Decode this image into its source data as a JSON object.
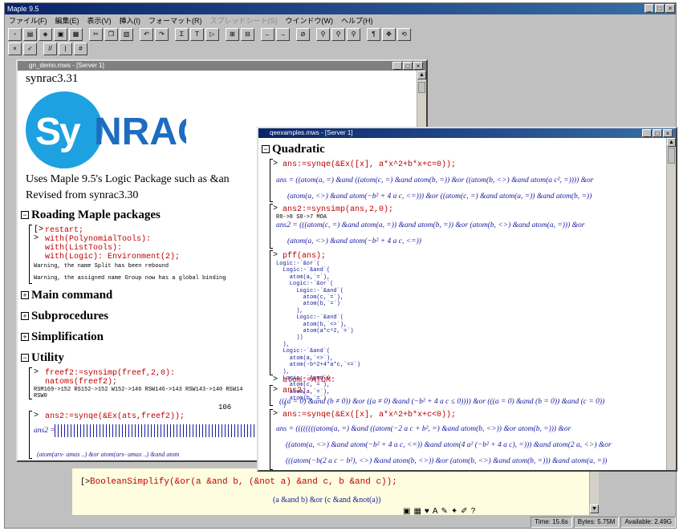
{
  "app": {
    "title": "Maple 9.5"
  },
  "menu": [
    "ファイル(F)",
    "編集(E)",
    "表示(V)",
    "挿入(I)",
    "フォーマット(R)",
    "スプレッドシート(S)",
    "ウインドウ(W)",
    "ヘルプ(H)"
  ],
  "win1": {
    "title": "gn_demo.mws - [Server 1]",
    "heading": "synrac3.31",
    "logo": "SyNRAC",
    "desc1": "Uses Maple 9.5's Logic Package such as &an",
    "desc2": "Revised from synrac3.30",
    "sections": {
      "s1": "Roading Maple packages",
      "s2": "Main command",
      "s3": "Subprocedures",
      "s4": "Simplification",
      "s5": "Utility"
    },
    "code1": "restart;\nwith(PolynomialTools):\nwith(ListTools):\nwith(Logic): Environment(2);",
    "warn1": "Warning, the name Split has been rebound",
    "warn2": "Warning, the assigned name Group now has a global binding",
    "code2": "freef2:=synsimp(freef,2,0):\nnatoms(freef2);",
    "out2": "RSM169->152 RS152->152 W152->146 RSW146->143 RSW143->140 RSW14\nRSW0",
    "num": "106",
    "code3": "ans2:=synqe(&Ex(ats,freef2));",
    "ans2": "ans2 =",
    "cut": "(atom(ars- amax ..) &or atom(ars- amax ..) &and atom"
  },
  "win2": {
    "title": "qeexamples.mws - [Server 1]",
    "heading": "Quadratic",
    "c1": "ans:=synqe(&Ex([x], a*x^2+b*x+c=0));",
    "m1a": "ans = ((atom(a, =) &and ((atom(c, =) &and atom(b, =)) &or ((atom(b, <>) &and atom(a c², =)))) &or",
    "m1b": "(atom(a, <>) &and atom(−b² + 4 a c, <=))) &or ((atom(c, =) &and atom(a, =)) &and atom(b, =))",
    "c2": "ans2:=synsimp(ans,2,0);",
    "o2": "R8->8 S8->7 MOA",
    "m2a": "ans2 = (((atom(c, =) &and atom(a, =)) &and atom(b, =)) &or (atom(b, <>) &and atom(a, =))) &or",
    "m2b": "(atom(a, <>) &and atom(−b² + 4 a c, <=))",
    "c3": "pff(ans);",
    "o3": "Logic:-`&or`(\n  Logic:-`&and`(\n    atom(a,`=`),\n    Logic:-`&or`(\n      Logic:-`&and`(\n        atom(c,`=`),\n        atom(b,`=`)\n      ),\n      Logic:-`&and`(\n        atom(b,`<>`),\n        atom(a*c^2,`=`)\n      ))\n  ),\n  Logic:-`&and`(\n    atom(a,`<>`),\n    atom(-b^2+4*a*c,`<=`)\n  ),\n  Logic:-`&and`(\n    atom(c,`=`),\n    atom(a,`=`),\n    atom(b,`=`)\n  )",
    "c4": "atom:=ATOM:",
    "c5": "ans2;",
    "m5": "(((a = 0) &and (b ≠ 0)) &or ((a ≠ 0) &and (−b² + 4 a c ≤ 0)))) &or (((a = 0) &and (b = 0)) &and (c = 0))",
    "c6": "ans:=synqe(&Ex([x], a*x^2+b*x+c<0));",
    "m6a": "ans = ((((((((atom(a, =) &and ((atom(−2 a c + b², =) &and atom(b, <>)) &or atom(b, =))) &or",
    "m6b": "((atom(a, <>) &and atom(−b² + 4 a c, <=)) &and atom(4 a² (−b² + 4 a c), =))) &and atom(2 a, <>) &or",
    "m6c": "(((atom(−b(2 a c − b²), <>) &and atom(b, <>)) &or (atom(b, <>) &and atom(b, =))) &and atom(a, =))"
  },
  "bottom": {
    "code": "BooleanSimplify(&or(a &and b, (&not a) &and c, b &and c));",
    "result": "(a &and b) &or (c &and &not(a))"
  },
  "status": {
    "time": "Time: 15.6s",
    "bytes": "Bytes: 5.75M",
    "avail": "Available: 2.49G"
  }
}
